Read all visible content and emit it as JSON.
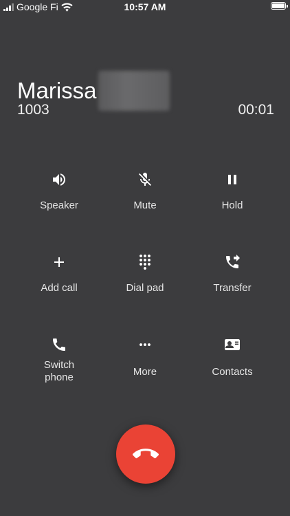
{
  "status_bar": {
    "carrier": "Google Fi",
    "time": "10:57 AM"
  },
  "caller": {
    "name": "Marissa",
    "number": "1003",
    "duration": "00:01"
  },
  "controls": {
    "speaker": "Speaker",
    "mute": "Mute",
    "hold": "Hold",
    "add_call": "Add call",
    "dial_pad": "Dial pad",
    "transfer": "Transfer",
    "switch_phone_line1": "Switch",
    "switch_phone_line2": "phone",
    "more": "More",
    "contacts": "Contacts"
  },
  "colors": {
    "background": "#3c3c3e",
    "end_call": "#ea4335"
  }
}
